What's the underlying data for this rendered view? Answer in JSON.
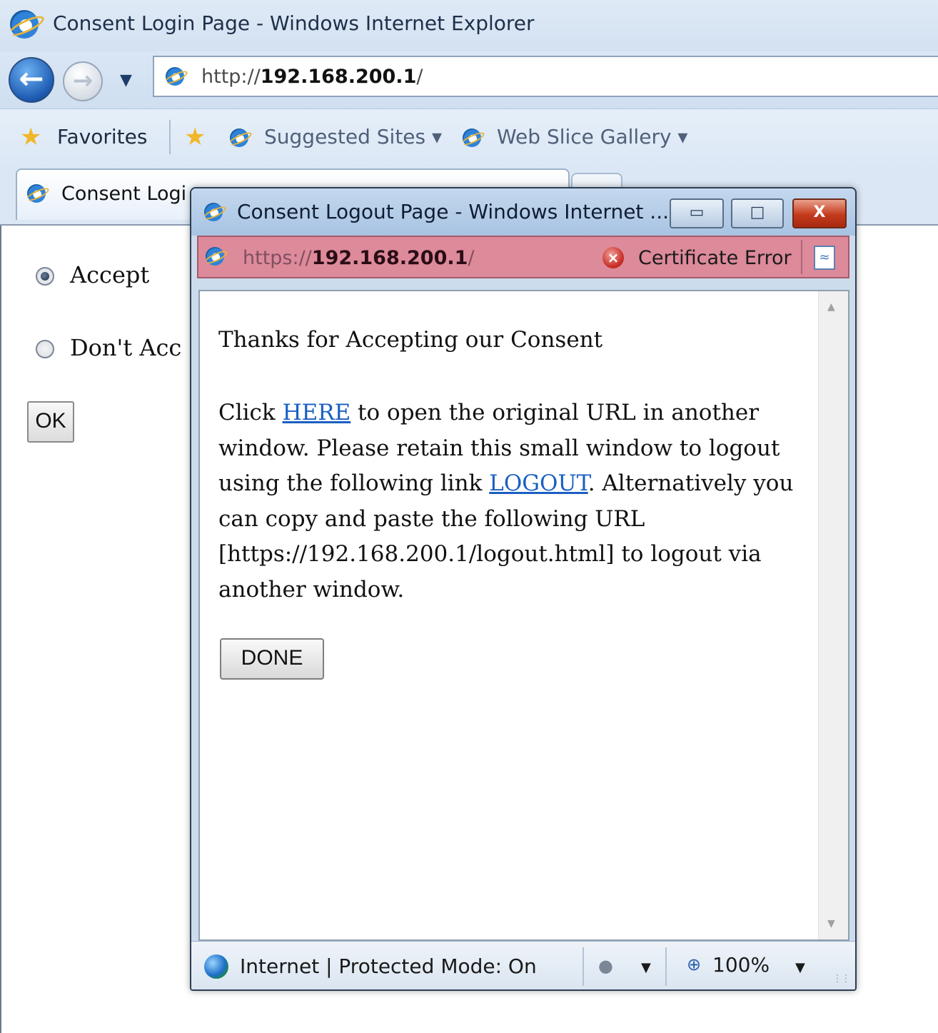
{
  "main_window": {
    "title": "Consent Login Page - Windows Internet Explorer",
    "address": {
      "prefix": "http://",
      "host": "192.168.200.1",
      "suffix": "/"
    },
    "favorites_bar": {
      "favorites_label": "Favorites",
      "items": [
        {
          "label": "Suggested Sites ▾"
        },
        {
          "label": "Web Slice Gallery ▾"
        }
      ]
    },
    "tab": {
      "label": "Consent Logi"
    },
    "page": {
      "radio_accept_label": "Accept",
      "radio_dont_accept_label": "Don't Acc",
      "ok_label": "OK"
    }
  },
  "popup": {
    "title": "Consent Logout Page - Windows Internet ...",
    "buttons": {
      "minimize": "▭",
      "restore": "□",
      "close": "X"
    },
    "address": {
      "prefix": "https://",
      "host": "192.168.200.1",
      "suffix": "/"
    },
    "certificate_error": "Certificate Error",
    "content": {
      "heading": "Thanks for Accepting our Consent",
      "click": "Click ",
      "here_link": "HERE",
      "text1": " to open the original URL in another window. Please retain this small window to logout using the following link ",
      "logout_link": "LOGOUT",
      "text2": ". Alternatively you can copy and paste the following URL [https://192.168.200.1/logout.html] to logout via another window.",
      "done_label": "DONE"
    },
    "status": {
      "zone": "Internet | Protected Mode: On",
      "zoom": "100%"
    }
  },
  "icons": {
    "ie": "ie-logo-icon",
    "back": "back-arrow-icon",
    "forward": "forward-arrow-icon",
    "favorites_star": "star-icon",
    "add_favorites": "add-favorite-icon",
    "cert_error": "shield-x-icon",
    "rss": "feed-icon",
    "globe": "globe-icon",
    "zoom": "magnifier-icon"
  },
  "colors": {
    "cert_error_bar": "#dd8a9a",
    "link": "#1a5fc2",
    "close_button": "#c43b1c"
  }
}
